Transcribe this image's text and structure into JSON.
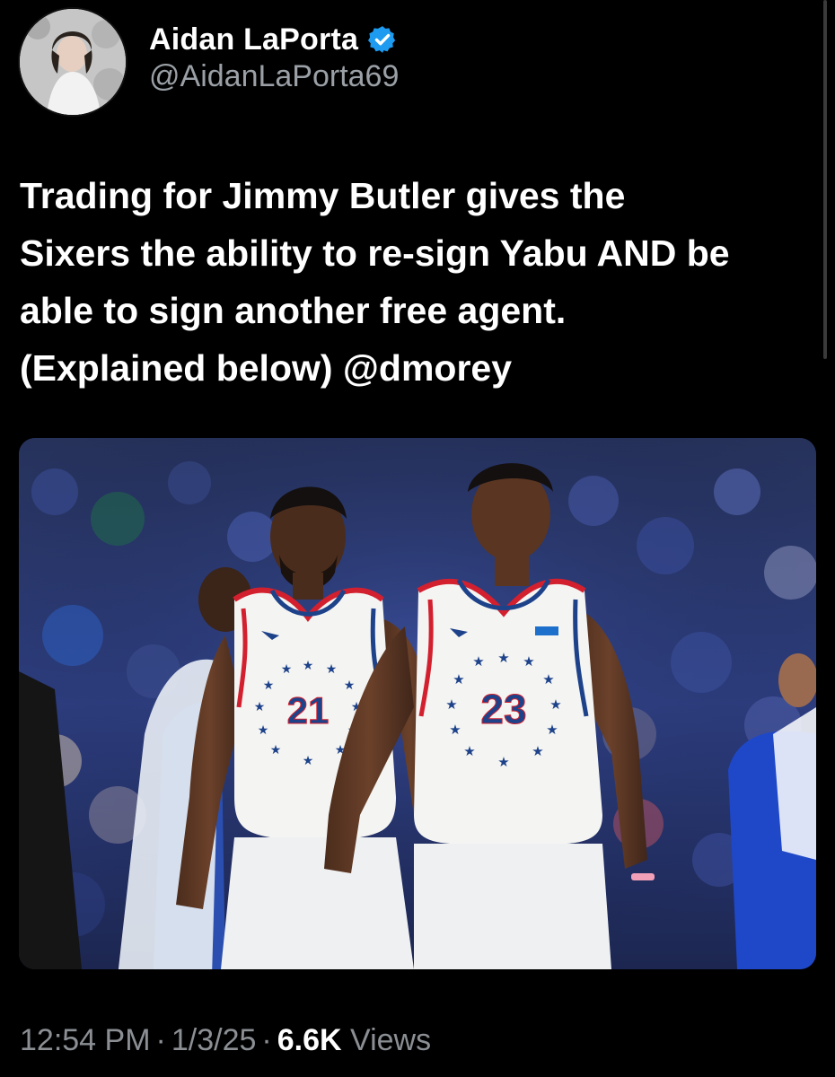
{
  "author": {
    "display_name": "Aidan LaPorta",
    "handle": "@AidanLaPorta69",
    "verified": true,
    "verified_icon": "verified-badge-icon",
    "verified_color": "#1d9bf0"
  },
  "tweet": {
    "lines": [
      "Trading for Jimmy Butler gives the",
      "Sixers the ability to re-sign Yabu AND be",
      "able to sign another free agent.",
      "(Explained below) @dmorey"
    ]
  },
  "photo": {
    "jersey_left_number": "21",
    "jersey_right_number": "23",
    "jersey_color": "#f4f4f2",
    "trim_red": "#d3202f",
    "trim_blue": "#1d428a"
  },
  "meta": {
    "time": "12:54 PM",
    "separator": "·",
    "date": "1/3/25",
    "views_count": "6.6K",
    "views_label": "Views"
  }
}
